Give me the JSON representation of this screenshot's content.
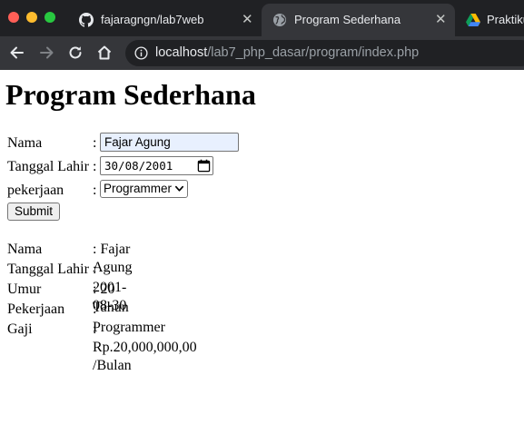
{
  "browser": {
    "tabs": [
      {
        "title": "fajaragngn/lab7web",
        "icon": "github-icon"
      },
      {
        "title": "Program Sederhana",
        "icon": "globe-icon",
        "active": true
      },
      {
        "title": "Praktikum",
        "icon": "google-drive-icon"
      }
    ],
    "close_glyph": "✕",
    "url_host": "localhost",
    "url_path": "/lab7_php_dasar/program/index.php"
  },
  "page": {
    "title": "Program Sederhana",
    "form": {
      "nama_label": "Nama",
      "nama_value": "Fajar Agung",
      "tanggal_label": "Tanggal Lahir",
      "tanggal_value": "30/08/2001",
      "pekerjaan_label": "pekerjaan",
      "pekerjaan_value": "Programmer",
      "submit_label": "Submit",
      "colon": ":"
    },
    "result": [
      {
        "label": "Nama",
        "value": ": Fajar Agung"
      },
      {
        "label": "Tanggal Lahir",
        "value": ": 2001-08-30"
      },
      {
        "label": "Umur",
        "value": ": 20 Tahun"
      },
      {
        "label": "Pekerjaan",
        "value": ": Programmer"
      },
      {
        "label": "Gaji",
        "value": ": Rp.20,000,000,00 /Bulan"
      }
    ]
  },
  "colors": {
    "chrome_dark": "#202124",
    "chrome_tab_active": "#35363a",
    "autofill": "#e8f0fe"
  }
}
